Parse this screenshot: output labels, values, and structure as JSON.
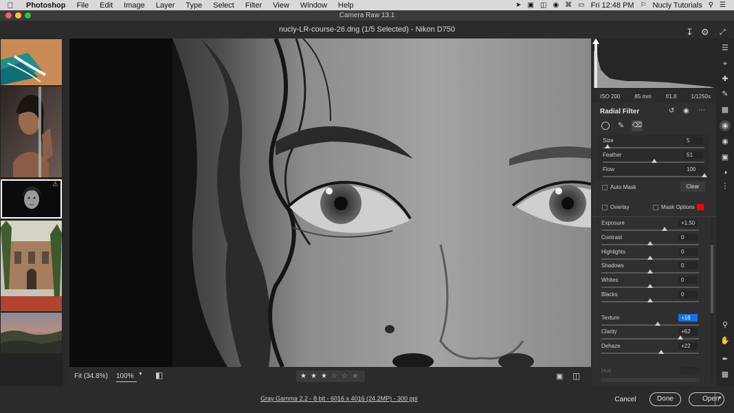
{
  "menubar": {
    "items": [
      "Photoshop",
      "File",
      "Edit",
      "Image",
      "Layer",
      "Type",
      "Select",
      "Filter",
      "View",
      "Window",
      "Help"
    ],
    "clock": "Fri 12:48 PM",
    "user": "Nucly Tutorials"
  },
  "window": {
    "title": "Camera Raw 13.1",
    "document": "nucly-LR-course-26.dng (1/5 Selected)  -  Nikon D750"
  },
  "exif": {
    "iso": "ISO 200",
    "focal": "85 mm",
    "aperture": "f/1.8",
    "shutter": "1/1250s"
  },
  "radial_filter": {
    "title": "Radial Filter",
    "brush": {
      "size_label": "Size",
      "size_value": "5",
      "size_level": 0.05,
      "feather_label": "Feather",
      "feather_value": "51",
      "feather_level": 0.51,
      "flow_label": "Flow",
      "flow_value": "100",
      "flow_level": 1.0
    },
    "auto_mask_label": "Auto Mask",
    "clear_label": "Clear",
    "overlay_label": "Overlay",
    "mask_options_label": "Mask Options",
    "mask_color": "#ff0000",
    "adjustments": [
      {
        "label": "Exposure",
        "value": "+1.50",
        "level": 0.65
      },
      {
        "label": "Contrast",
        "value": "0",
        "level": 0.5
      },
      {
        "label": "Highlights",
        "value": "0",
        "level": 0.5
      },
      {
        "label": "Shadows",
        "value": "0",
        "level": 0.5
      },
      {
        "label": "Whites",
        "value": "0",
        "level": 0.5
      },
      {
        "label": "Blacks",
        "value": "0",
        "level": 0.5
      },
      {
        "label": "Texture",
        "value": "+16",
        "level": 0.58
      },
      {
        "label": "Clarity",
        "value": "+62",
        "level": 0.81
      },
      {
        "label": "Dehaze",
        "value": "+22",
        "level": 0.61
      }
    ],
    "hue_label": "Hue"
  },
  "viewbar": {
    "fit_label": "Fit (34.8%)",
    "zoom_value": "100%",
    "rating": 3
  },
  "footer": {
    "workflow": "Gray Gamma 2.2 - 8 bit - 6016 x 4016 (24.2MP) - 300 ppi",
    "cancel_label": "Cancel",
    "done_label": "Done",
    "open_label": "Open"
  },
  "colors": {
    "accent": "#1473e6",
    "warning": "#f5c518"
  }
}
